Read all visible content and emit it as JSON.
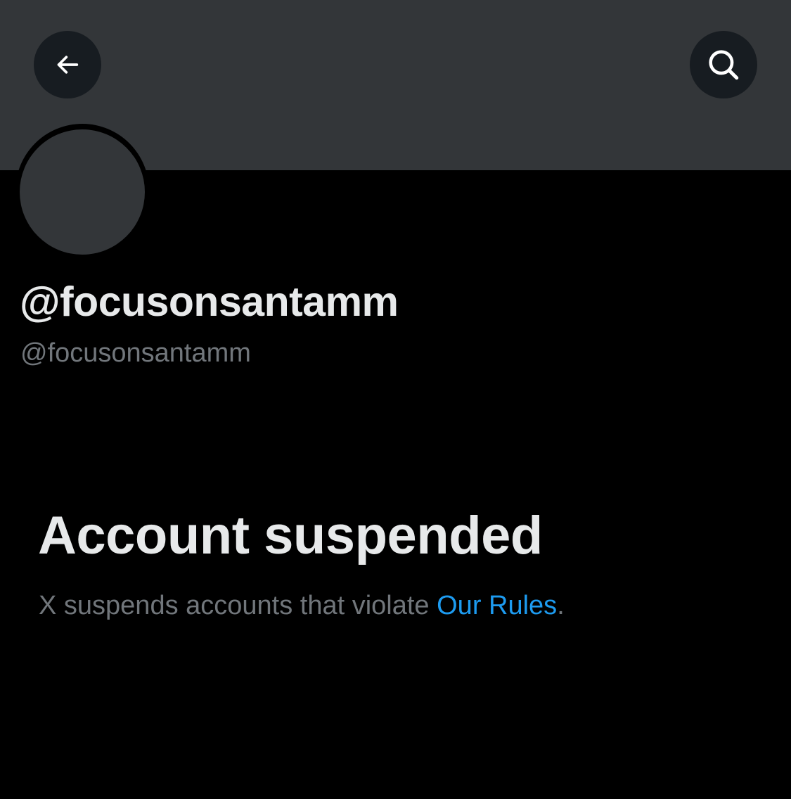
{
  "header": {
    "back_icon": "arrow-left-icon",
    "search_icon": "search-icon"
  },
  "profile": {
    "display_name": "@focusonsantamm",
    "handle": "@focusonsantamm"
  },
  "suspension": {
    "title": "Account suspended",
    "text_before": "X suspends accounts that violate ",
    "link_text": "Our Rules",
    "text_after": "."
  },
  "colors": {
    "background": "#000000",
    "banner": "#333639",
    "primary_text": "#e7e9ea",
    "secondary_text": "#71767b",
    "link": "#1d9bf0"
  }
}
